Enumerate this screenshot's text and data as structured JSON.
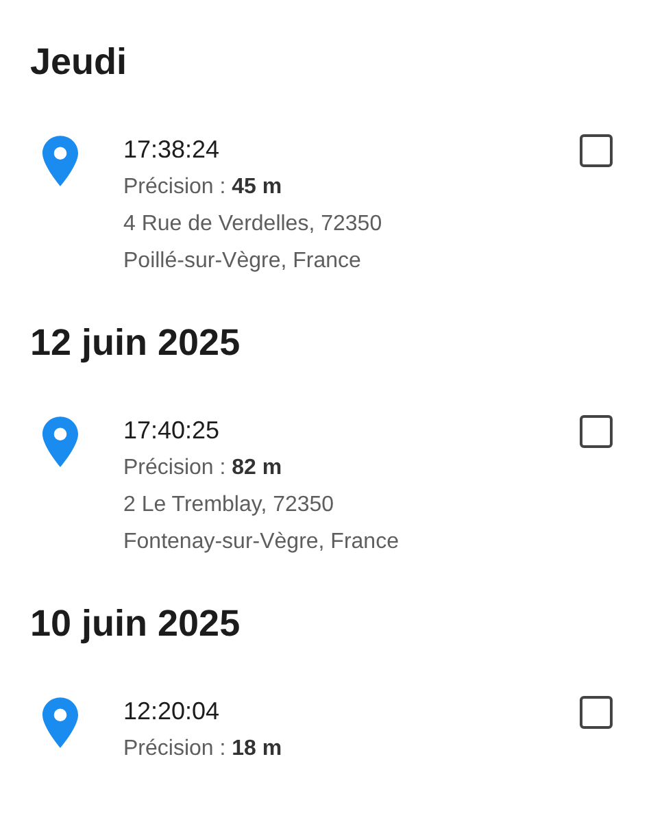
{
  "sections": [
    {
      "heading": "Jeudi",
      "entries": [
        {
          "time": "17:38:24",
          "precision": "Précision : **45 m**",
          "address": [
            "4 Rue de Verdelles, 72350",
            "Poillé-sur-Vègre, France"
          ],
          "checked": false
        }
      ]
    },
    {
      "heading": "12 juin 2025",
      "entries": [
        {
          "time": "17:40:25",
          "precision": "Précision : **82 m**",
          "address": [
            "2 Le Tremblay, 72350",
            "Fontenay-sur-Vègre, France"
          ],
          "checked": false
        }
      ]
    },
    {
      "heading": "10 juin 2025",
      "entries": [
        {
          "time": "12:20:04",
          "precision": "Précision : **18 m**",
          "checked": false
        }
      ]
    }
  ]
}
